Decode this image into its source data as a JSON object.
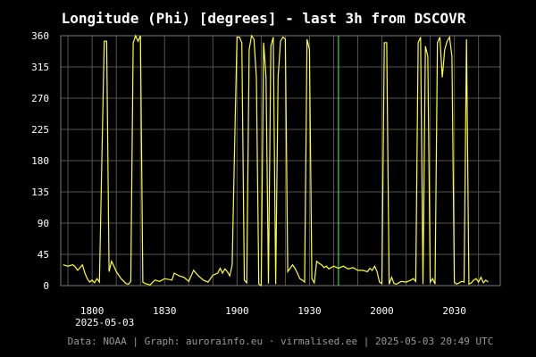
{
  "chart_data": {
    "type": "line",
    "title": "Longitude (Phi) [degrees] - last 3h from DSCOVR",
    "xlabel": "",
    "ylabel": "",
    "date_label": "2025-05-03",
    "x_range": [
      "17:47",
      "20:49"
    ],
    "ylim": [
      0,
      360
    ],
    "yticks": [
      0,
      45,
      90,
      135,
      180,
      225,
      270,
      315,
      360
    ],
    "xticks": [
      {
        "time": "18:00",
        "label": "1800"
      },
      {
        "time": "18:30",
        "label": "1830"
      },
      {
        "time": "19:00",
        "label": "1900"
      },
      {
        "time": "19:30",
        "label": "1930"
      },
      {
        "time": "20:00",
        "label": "2000"
      },
      {
        "time": "20:30",
        "label": "2030"
      }
    ],
    "grid": true,
    "line_color": "#ffff33",
    "marker_color": "#33ff66",
    "markers": [
      "19:42"
    ],
    "series": [
      {
        "values": [
          [
            "17:48",
            30
          ],
          [
            "17:50",
            28
          ],
          [
            "17:52",
            30
          ],
          [
            "17:53",
            27
          ],
          [
            "17:54",
            22
          ],
          [
            "17:56",
            30
          ],
          [
            "17:57",
            18
          ],
          [
            "17:58",
            10
          ],
          [
            "17:59",
            5
          ],
          [
            "18:00",
            8
          ],
          [
            "18:01",
            4
          ],
          [
            "18:02",
            10
          ],
          [
            "18:03",
            5
          ],
          [
            "18:04",
            180
          ],
          [
            "18:05",
            352
          ],
          [
            "18:06",
            352
          ],
          [
            "18:07",
            20
          ],
          [
            "18:08",
            35
          ],
          [
            "18:09",
            28
          ],
          [
            "18:10",
            20
          ],
          [
            "18:12",
            10
          ],
          [
            "18:14",
            3
          ],
          [
            "18:15",
            2
          ],
          [
            "18:16",
            6
          ],
          [
            "18:17",
            350
          ],
          [
            "18:18",
            360
          ],
          [
            "18:19",
            352
          ],
          [
            "18:20",
            360
          ],
          [
            "18:21",
            5
          ],
          [
            "18:22",
            3
          ],
          [
            "18:24",
            1
          ],
          [
            "18:26",
            8
          ],
          [
            "18:28",
            6
          ],
          [
            "18:30",
            10
          ],
          [
            "18:33",
            8
          ],
          [
            "18:34",
            18
          ],
          [
            "18:36",
            14
          ],
          [
            "18:38",
            12
          ],
          [
            "18:40",
            6
          ],
          [
            "18:42",
            22
          ],
          [
            "18:44",
            14
          ],
          [
            "18:46",
            8
          ],
          [
            "18:48",
            5
          ],
          [
            "18:50",
            15
          ],
          [
            "18:52",
            18
          ],
          [
            "18:53",
            25
          ],
          [
            "18:54",
            18
          ],
          [
            "18:55",
            24
          ],
          [
            "18:56",
            20
          ],
          [
            "18:57",
            14
          ],
          [
            "18:58",
            30
          ],
          [
            "18:59",
            200
          ],
          [
            "19:00",
            358
          ],
          [
            "19:01",
            358
          ],
          [
            "19:02",
            350
          ],
          [
            "19:03",
            8
          ],
          [
            "19:04",
            4
          ],
          [
            "19:05",
            340
          ],
          [
            "19:06",
            360
          ],
          [
            "19:07",
            355
          ],
          [
            "19:08",
            300
          ],
          [
            "19:09",
            2
          ],
          [
            "19:10",
            0
          ],
          [
            "19:11",
            350
          ],
          [
            "19:12",
            300
          ],
          [
            "19:13",
            3
          ],
          [
            "19:14",
            345
          ],
          [
            "19:15",
            358
          ],
          [
            "19:16",
            2
          ],
          [
            "19:17",
            300
          ],
          [
            "19:18",
            352
          ],
          [
            "19:19",
            358
          ],
          [
            "19:20",
            355
          ],
          [
            "19:21",
            20
          ],
          [
            "19:22",
            25
          ],
          [
            "19:23",
            30
          ],
          [
            "19:24",
            25
          ],
          [
            "19:25",
            18
          ],
          [
            "19:26",
            10
          ],
          [
            "19:27",
            8
          ],
          [
            "19:28",
            5
          ],
          [
            "19:29",
            355
          ],
          [
            "19:30",
            340
          ],
          [
            "19:31",
            10
          ],
          [
            "19:32",
            4
          ],
          [
            "19:33",
            35
          ],
          [
            "19:34",
            32
          ],
          [
            "19:35",
            30
          ],
          [
            "19:36",
            26
          ],
          [
            "19:37",
            28
          ],
          [
            "19:38",
            24
          ],
          [
            "19:40",
            28
          ],
          [
            "19:42",
            25
          ],
          [
            "19:44",
            28
          ],
          [
            "19:46",
            24
          ],
          [
            "19:48",
            26
          ],
          [
            "19:50",
            22
          ],
          [
            "19:52",
            22
          ],
          [
            "19:54",
            20
          ],
          [
            "19:55",
            25
          ],
          [
            "19:56",
            22
          ],
          [
            "19:57",
            28
          ],
          [
            "19:58",
            20
          ],
          [
            "19:59",
            5
          ],
          [
            "20:00",
            3
          ],
          [
            "20:01",
            350
          ],
          [
            "20:02",
            350
          ],
          [
            "20:03",
            2
          ],
          [
            "20:04",
            12
          ],
          [
            "20:05",
            3
          ],
          [
            "20:06",
            2
          ],
          [
            "20:08",
            6
          ],
          [
            "20:10",
            5
          ],
          [
            "20:12",
            8
          ],
          [
            "20:13",
            10
          ],
          [
            "20:14",
            6
          ],
          [
            "20:15",
            350
          ],
          [
            "20:16",
            358
          ],
          [
            "20:17",
            2
          ],
          [
            "20:18",
            345
          ],
          [
            "20:19",
            330
          ],
          [
            "20:20",
            5
          ],
          [
            "20:21",
            10
          ],
          [
            "20:22",
            2
          ],
          [
            "20:23",
            350
          ],
          [
            "20:24",
            358
          ],
          [
            "20:25",
            300
          ],
          [
            "20:26",
            340
          ],
          [
            "20:27",
            352
          ],
          [
            "20:28",
            358
          ],
          [
            "20:29",
            330
          ],
          [
            "20:30",
            5
          ],
          [
            "20:31",
            2
          ],
          [
            "20:32",
            4
          ],
          [
            "20:33",
            6
          ],
          [
            "20:34",
            5
          ],
          [
            "20:35",
            355
          ],
          [
            "20:36",
            2
          ],
          [
            "20:37",
            4
          ],
          [
            "20:38",
            8
          ],
          [
            "20:39",
            10
          ],
          [
            "20:40",
            5
          ],
          [
            "20:41",
            12
          ],
          [
            "20:42",
            4
          ],
          [
            "20:43",
            8
          ],
          [
            "20:44",
            5
          ]
        ]
      }
    ]
  },
  "footer": "Data: NOAA | Graph: aurorainfo.eu · virmalised.ee | 2025-05-03 20:49 UTC"
}
